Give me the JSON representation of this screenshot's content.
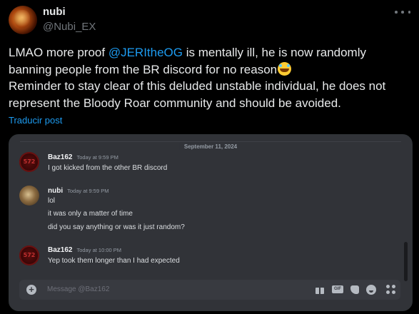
{
  "tweet": {
    "display_name": "nubi",
    "handle": "@Nubi_EX",
    "text_part1": "LMAO more proof ",
    "mention": "@JERItheOG",
    "text_part2": " is mentally ill, he is now randomly banning people from the BR discord for no reason",
    "emoji": "rolling-on-floor-laughing-emoji",
    "text_part3": "Reminder to stay clear of this deluded unstable individual, he does not represent the Bloody Roar community and should be avoided.",
    "translate_label": "Traducir post",
    "more_icon": "more-horizontal-icon"
  },
  "discord": {
    "date_divider": "September 11, 2024",
    "messages": [
      {
        "author": "Baz162",
        "timestamp": "Today at 9:59 PM",
        "lines": [
          "I got kicked from the other BR discord"
        ]
      },
      {
        "author": "nubi",
        "timestamp": "Today at 9:59 PM",
        "lines": [
          "lol",
          "it was only a matter of time",
          "did you say anything or was it just random?"
        ]
      },
      {
        "author": "Baz162",
        "timestamp": "Today at 10:00 PM",
        "lines": [
          "Yep took them longer than I had expected"
        ]
      }
    ],
    "composer": {
      "placeholder": "Message @Baz162",
      "gif_label": "GIF"
    }
  },
  "colors": {
    "background": "#000000",
    "text": "#e7e9ea",
    "secondary_text": "#71767b",
    "link": "#1d9bf0",
    "discord_bg": "#313338",
    "composer_bg": "#383a40"
  }
}
